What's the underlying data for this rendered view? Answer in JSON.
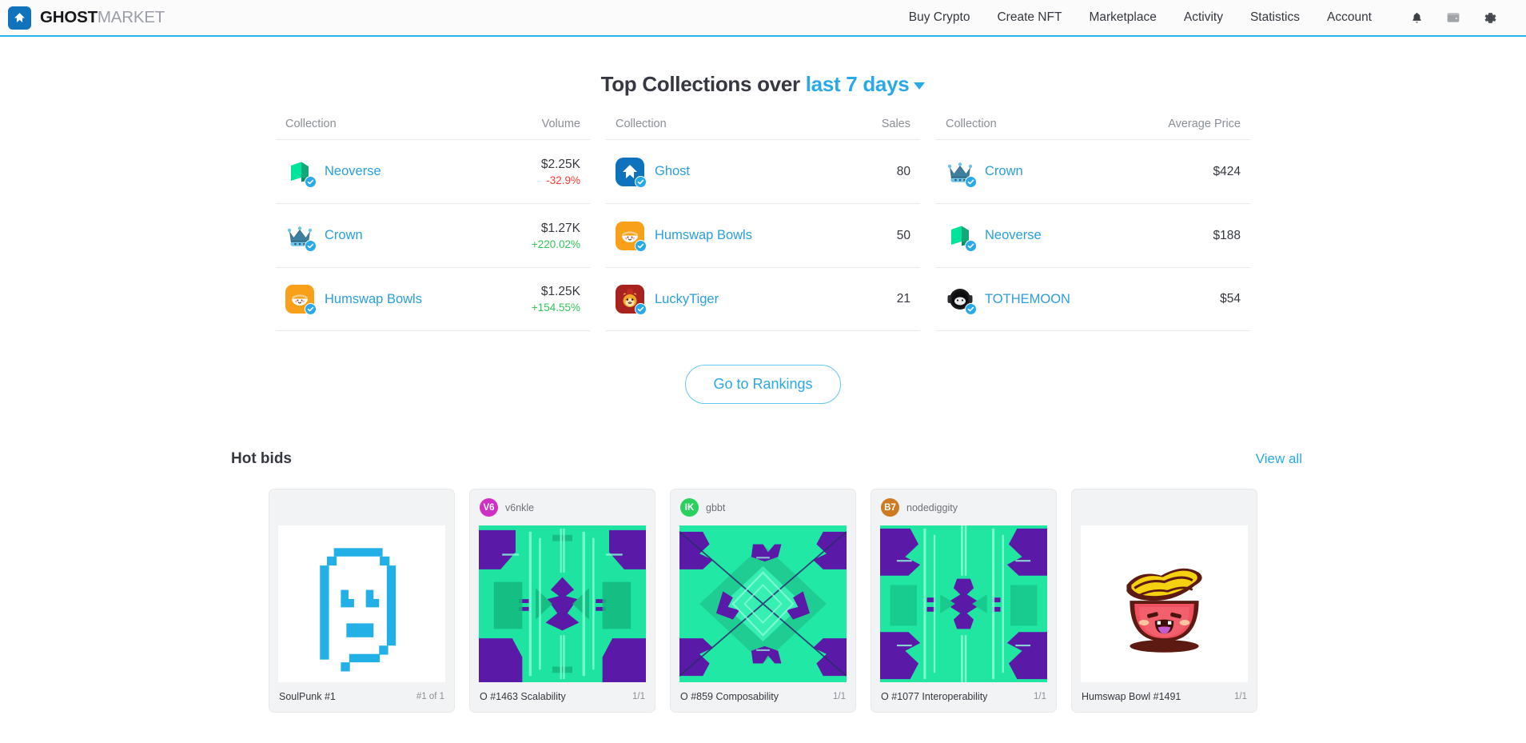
{
  "header": {
    "brand_bold": "GHOST",
    "brand_light": "MARKET",
    "logo_icon": "ghost-diamond-icon",
    "nav": [
      {
        "label": "Buy Crypto"
      },
      {
        "label": "Create NFT"
      },
      {
        "label": "Marketplace"
      },
      {
        "label": "Activity"
      },
      {
        "label": "Statistics"
      },
      {
        "label": "Account"
      }
    ],
    "icons": [
      {
        "name": "bell-icon"
      },
      {
        "name": "wallet-icon"
      },
      {
        "name": "gear-icon"
      }
    ],
    "accent_color": "#2bb2ea"
  },
  "rankings": {
    "title_prefix": "Top Collections over",
    "title_period": "last 7 days",
    "columns": [
      {
        "header_left": "Collection",
        "header_right": "Volume",
        "rows": [
          {
            "name": "Neoverse",
            "logo": "neoverse-cube-logo",
            "verified": true,
            "value": "$2.25K",
            "delta": "-32.9%",
            "delta_dir": "down"
          },
          {
            "name": "Crown",
            "logo": "crown-logo",
            "verified": true,
            "value": "$1.27K",
            "delta": "+220.02%",
            "delta_dir": "up"
          },
          {
            "name": "Humswap Bowls",
            "logo": "humswap-bowl-logo",
            "verified": true,
            "value": "$1.25K",
            "delta": "+154.55%",
            "delta_dir": "up"
          }
        ]
      },
      {
        "header_left": "Collection",
        "header_right": "Sales",
        "rows": [
          {
            "name": "Ghost",
            "logo": "ghost-diamond-logo",
            "verified": true,
            "value": "80",
            "delta": "",
            "delta_dir": ""
          },
          {
            "name": "Humswap Bowls",
            "logo": "humswap-bowl-logo",
            "verified": true,
            "value": "50",
            "delta": "",
            "delta_dir": ""
          },
          {
            "name": "LuckyTiger",
            "logo": "lucky-tiger-logo",
            "verified": true,
            "value": "21",
            "delta": "",
            "delta_dir": ""
          }
        ]
      },
      {
        "header_left": "Collection",
        "header_right": "Average Price",
        "rows": [
          {
            "name": "Crown",
            "logo": "crown-logo",
            "verified": true,
            "value": "$424",
            "delta": "",
            "delta_dir": ""
          },
          {
            "name": "Neoverse",
            "logo": "neoverse-cube-logo",
            "verified": true,
            "value": "$188",
            "delta": "",
            "delta_dir": ""
          },
          {
            "name": "TOTHEMOON",
            "logo": "astronaut-helmet-logo",
            "verified": true,
            "value": "$54",
            "delta": "",
            "delta_dir": ""
          }
        ]
      }
    ],
    "button_label": "Go to Rankings"
  },
  "hot_bids": {
    "title": "Hot bids",
    "view_all": "View all",
    "cards": [
      {
        "user": "",
        "avatar_initials": "",
        "avatar_color": "",
        "art": "soulpunk",
        "name": "SoulPunk #1",
        "edition": "#1 of 1"
      },
      {
        "user": "v6nkle",
        "avatar_initials": "V6",
        "avatar_color": "#cf30c4",
        "art": "generative-vertical",
        "name": "O #1463 Scalability",
        "edition": "1/1"
      },
      {
        "user": "gbbt",
        "avatar_initials": "IK",
        "avatar_color": "#29d15e",
        "art": "generative-diagonal",
        "name": "O #859 Composability",
        "edition": "1/1"
      },
      {
        "user": "nodediggity",
        "avatar_initials": "B7",
        "avatar_color": "#cd7a22",
        "art": "generative-vertical2",
        "name": "O #1077 Interoperability",
        "edition": "1/1"
      },
      {
        "user": "",
        "avatar_initials": "",
        "avatar_color": "",
        "art": "humswap-bowl",
        "name": "Humswap Bowl #1491",
        "edition": "1/1"
      }
    ]
  }
}
